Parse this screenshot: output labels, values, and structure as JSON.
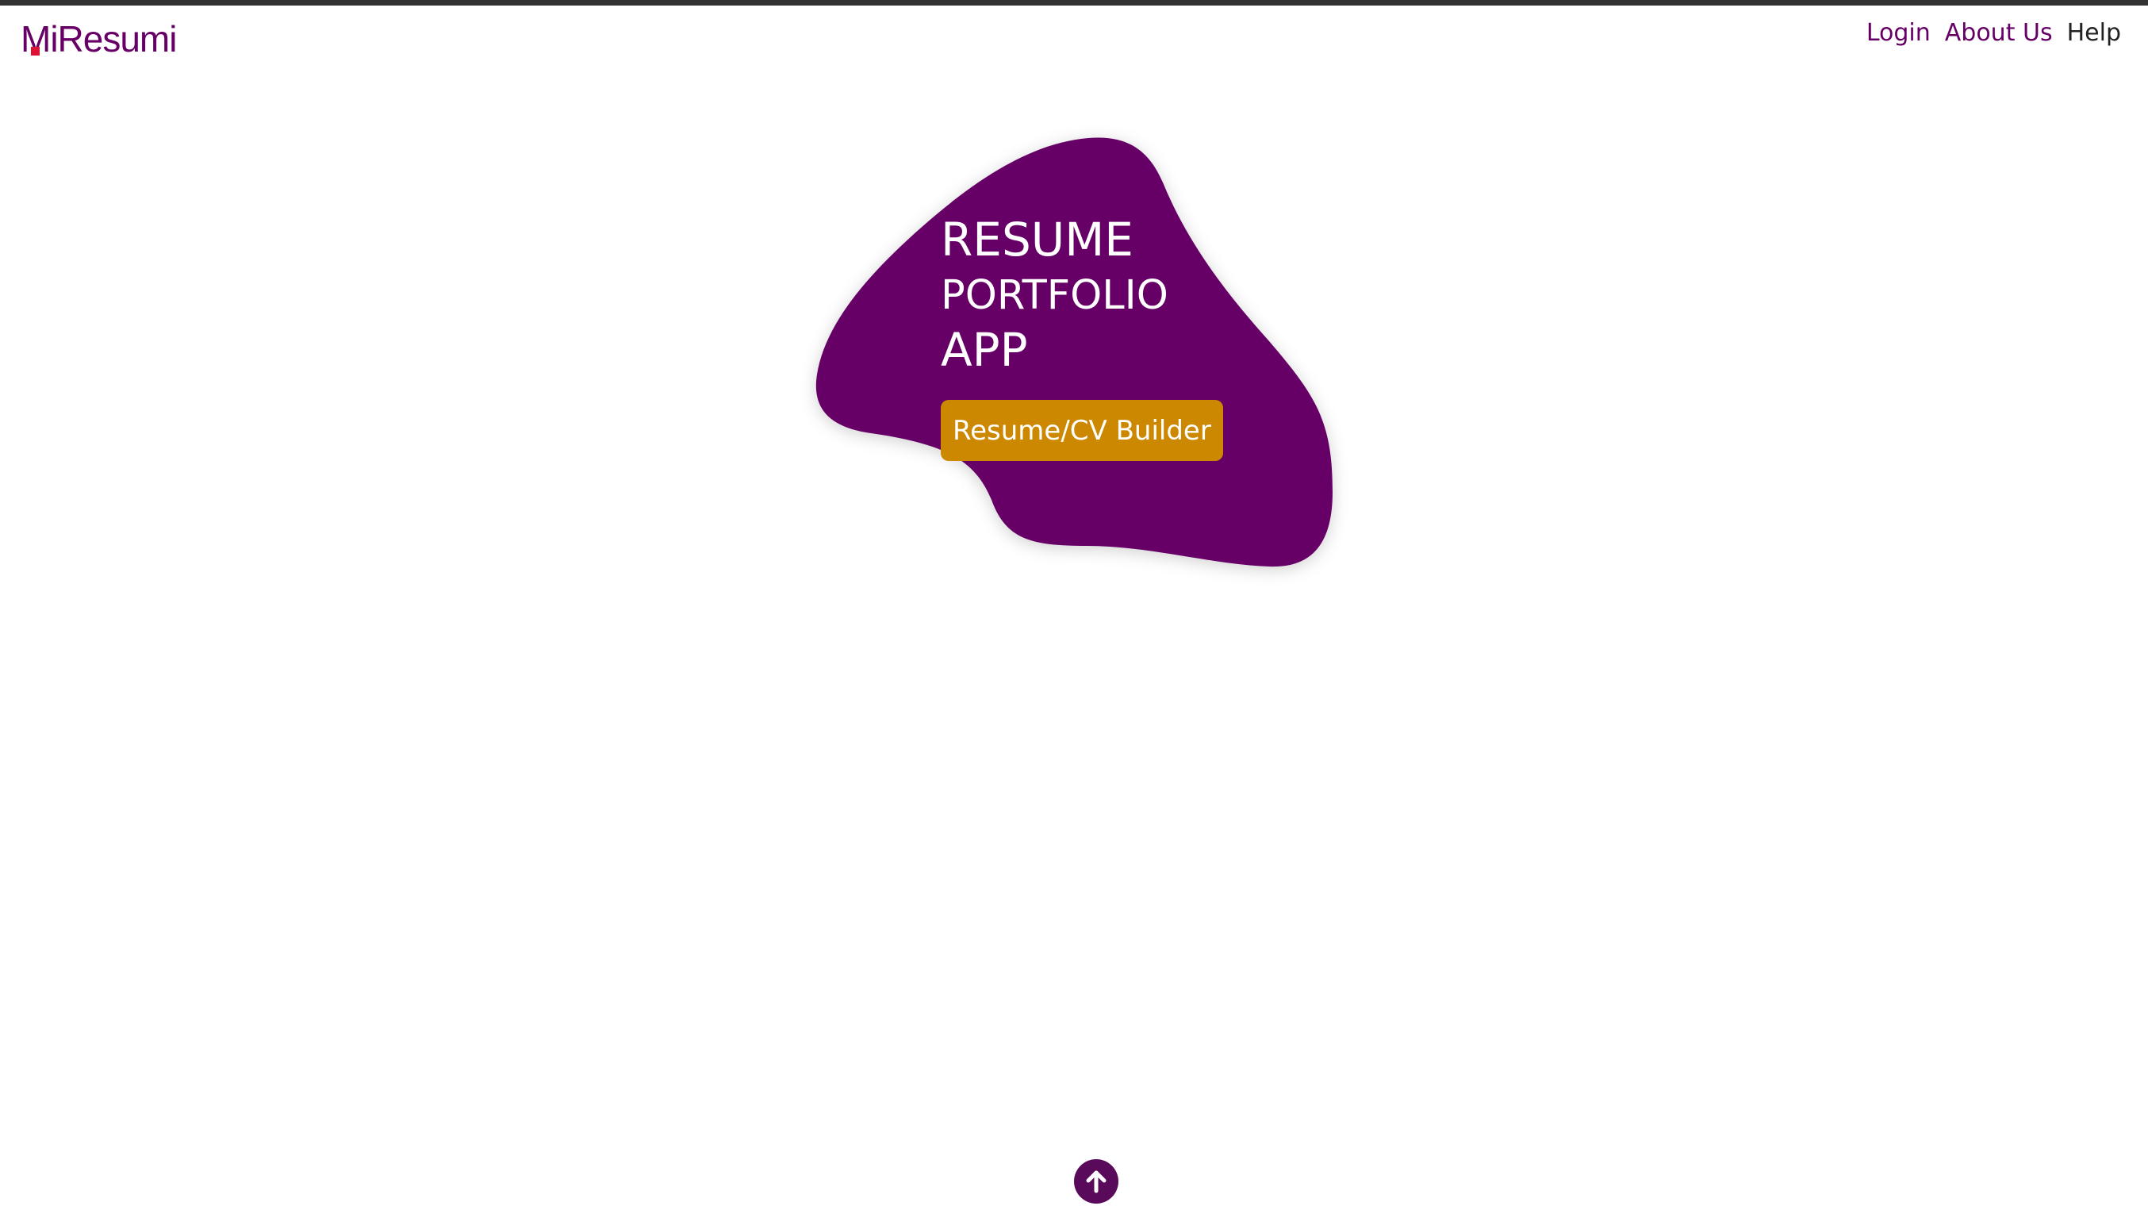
{
  "brand": {
    "logo_first_letter": "M",
    "logo_rest": "iResumi",
    "logo_color": "#660066",
    "logo_accent_color": "#dd1133"
  },
  "nav": {
    "items": [
      {
        "label": "Login",
        "color": "#660066"
      },
      {
        "label": "About Us",
        "color": "#660066"
      },
      {
        "label": "Help",
        "color": "#222222"
      }
    ]
  },
  "hero": {
    "line1": "RESUME",
    "line2": "PORTFOLIO",
    "line3": "APP",
    "blob_color": "#660066",
    "cta_label": "Resume/CV Builder",
    "cta_color": "#cc8800"
  },
  "scroll_top": {
    "icon": "arrow-up-icon",
    "color": "#5a0a5a"
  }
}
